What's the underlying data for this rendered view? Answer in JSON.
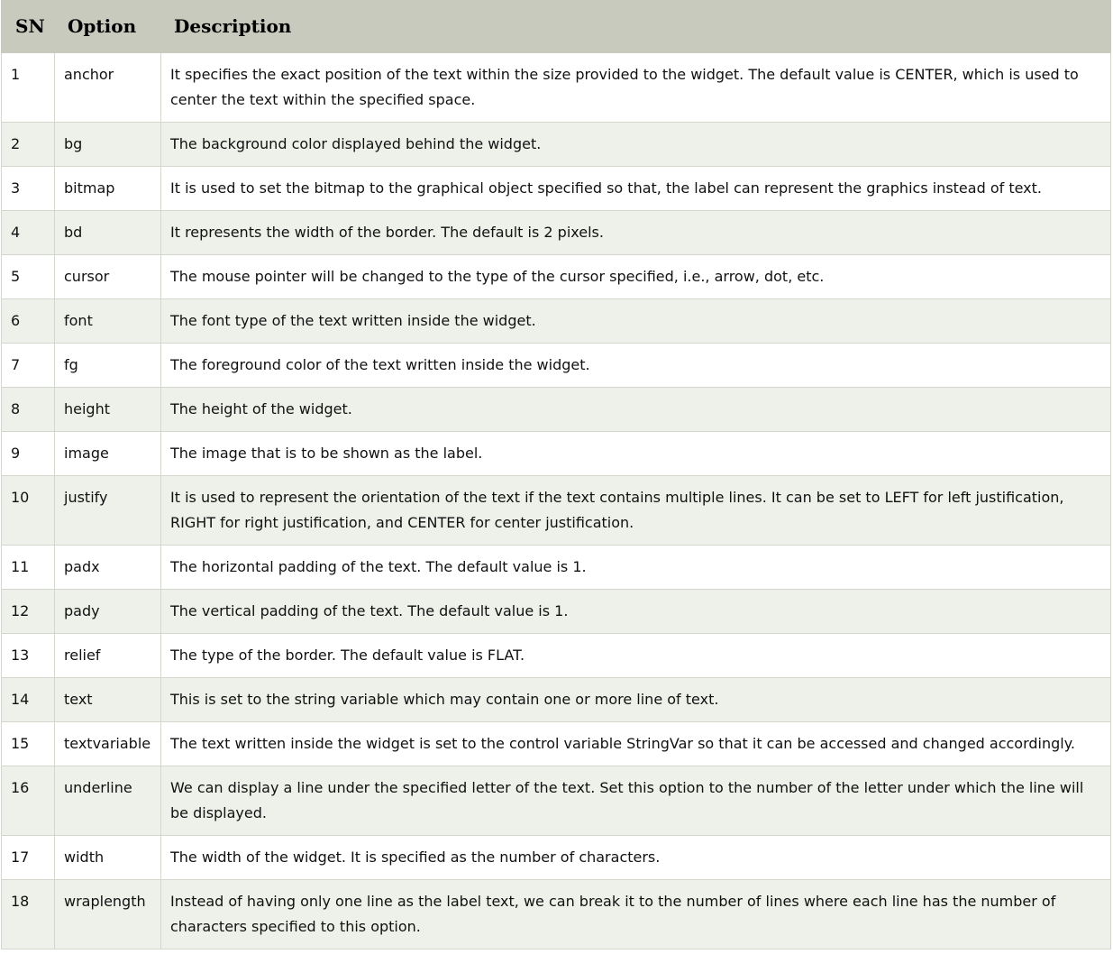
{
  "table": {
    "headers": {
      "sn": "SN",
      "option": "Option",
      "description": "Description"
    },
    "rows": [
      {
        "sn": "1",
        "option": "anchor",
        "description": "It specifies the exact position of the text within the size provided to the widget. The default value is CENTER, which is used to center the text within the specified space."
      },
      {
        "sn": "2",
        "option": "bg",
        "description": "The background color displayed behind the widget."
      },
      {
        "sn": "3",
        "option": "bitmap",
        "description": "It is used to set the bitmap to the graphical object specified so that, the label can represent the graphics instead of text."
      },
      {
        "sn": "4",
        "option": "bd",
        "description": "It represents the width of the border. The default is 2 pixels."
      },
      {
        "sn": "5",
        "option": "cursor",
        "description": "The mouse pointer will be changed to the type of the cursor specified, i.e., arrow, dot, etc."
      },
      {
        "sn": "6",
        "option": "font",
        "description": "The font type of the text written inside the widget."
      },
      {
        "sn": "7",
        "option": "fg",
        "description": "The foreground color of the text written inside the widget."
      },
      {
        "sn": "8",
        "option": "height",
        "description": "The height of the widget."
      },
      {
        "sn": "9",
        "option": "image",
        "description": "The image that is to be shown as the label."
      },
      {
        "sn": "10",
        "option": "justify",
        "description": "It is used to represent the orientation of the text if the text contains multiple lines. It can be set to LEFT for left justification, RIGHT for right justification, and CENTER for center justification."
      },
      {
        "sn": "11",
        "option": "padx",
        "description": "The horizontal padding of the text. The default value is 1."
      },
      {
        "sn": "12",
        "option": "pady",
        "description": "The vertical padding of the text. The default value is 1."
      },
      {
        "sn": "13",
        "option": "relief",
        "description": "The type of the border. The default value is FLAT."
      },
      {
        "sn": "14",
        "option": "text",
        "description": "This is set to the string variable which may contain one or more line of text."
      },
      {
        "sn": "15",
        "option": "textvariable",
        "description": "The text written inside the widget is set to the control variable StringVar so that it can be accessed and changed accordingly."
      },
      {
        "sn": "16",
        "option": "underline",
        "description": "We can display a line under the specified letter of the text. Set this option to the number of the letter under which the line will be displayed."
      },
      {
        "sn": "17",
        "option": "width",
        "description": "The width of the widget. It is specified as the number of characters."
      },
      {
        "sn": "18",
        "option": "wraplength",
        "description": "Instead of having only one line as the label text, we can break it to the number of lines where each line has the number of characters specified to this option."
      }
    ]
  },
  "colors": {
    "header_bg": "#c7cabd",
    "row_alt_bg": "#eef0ea",
    "border": "#d3d6cc"
  }
}
